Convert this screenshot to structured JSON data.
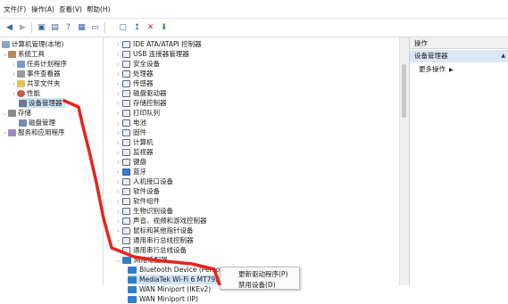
{
  "menubar": {
    "items": [
      "文件(F)",
      "操作(A)",
      "查看(V)",
      "帮助(H)"
    ]
  },
  "toolbar": {
    "icons": [
      "back-icon",
      "forward-icon",
      "folder-icon",
      "properties-icon",
      "help-icon",
      "details-icon",
      "monitor-icon",
      "scan-icon",
      "uninstall-icon",
      "update-icon"
    ]
  },
  "left": {
    "root": "计算机管理(本地)",
    "system_tools": "系统工具",
    "task_scheduler": "任务计划程序",
    "event_viewer": "事件查看器",
    "shared_folders": "共享文件夹",
    "performance": "性能",
    "device_manager": "设备管理器",
    "storage": "存储",
    "disk_management": "磁盘管理",
    "services": "服务和应用程序"
  },
  "center": {
    "categories": [
      "IDE ATA/ATAPI 控制器",
      "USB 连接器管理器",
      "安全设备",
      "处理器",
      "传感器",
      "磁盘驱动器",
      "存储控制器",
      "打印队列",
      "电池",
      "固件",
      "计算机",
      "监视器",
      "键盘",
      "蓝牙",
      "人机接口设备",
      "软件设备",
      "软件组件",
      "生物识别设备",
      "声音、视频和游戏控制器",
      "鼠标和其他指针设备",
      "通用串行总线控制器",
      "通用串行总线设备",
      "网络适配器"
    ],
    "network_children": [
      "Bluetooth Device (Personal Area Network)",
      "MediaTek Wi-Fi 6 MT7921 Wireless LAN Card",
      "WAN Miniport (IKEv2)",
      "WAN Miniport (IP)"
    ]
  },
  "right": {
    "header": "操作",
    "section": "设备管理器",
    "more": "更多操作"
  },
  "context_menu": {
    "items": [
      "更新驱动程序(P)",
      "禁用设备(D)"
    ]
  },
  "colors": {
    "annotation": "#e8231b",
    "selection": "#cfe3f7",
    "accent": "#2f7dd1"
  }
}
